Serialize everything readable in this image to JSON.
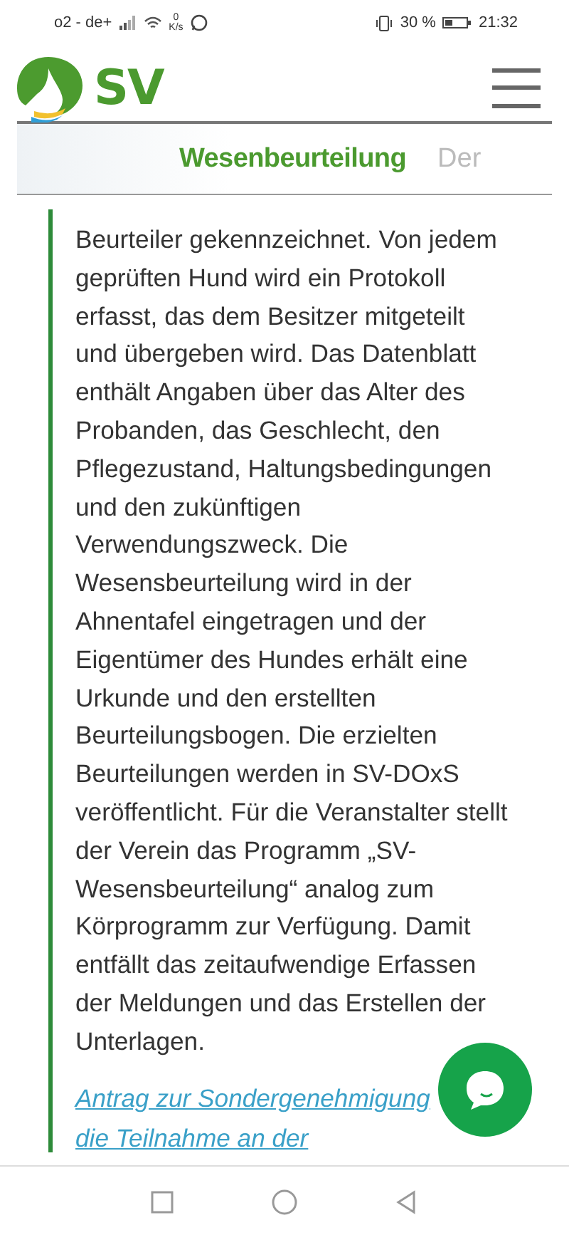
{
  "status_bar": {
    "carrier": "o2 - de+",
    "speed_value": "0",
    "speed_unit": "K/s",
    "battery_percent": "30 %",
    "time": "21:32"
  },
  "header": {
    "logo_text": "SV"
  },
  "tabs": [
    {
      "label": "Wesenbeurteilung",
      "selected": true
    },
    {
      "label": "Der",
      "selected": false
    }
  ],
  "article": {
    "paragraph": "Beurteiler gekennzeichnet. Von jedem geprüften Hund wird ein Protokoll erfasst, das dem Besitzer mitgeteilt und übergeben wird. Das Datenblatt enthält Angaben über das Alter des Probanden, das Geschlecht, den Pflegezustand, Haltungsbedingungen und den zukünftigen Verwendungszweck. Die Wesensbeurteilung wird in der Ahnentafel eingetragen und der Eigentümer des Hundes erhält eine Urkunde und den erstellten Beurteilungsbogen. Die erzielten Beurteilungen werden in SV-DOxS veröffentlicht. Für die Veranstalter stellt der Verein das Programm „SV-Wesensbeurteilung“ analog zum Körprogramm zur Verfügung. Damit entfällt das zeitaufwendige Erfassen der Meldungen und das Erstellen der Unterlagen.",
    "link_lines": [
      "Antrag zur Sondergenehmigung",
      "die Teilnahme an der"
    ]
  }
}
